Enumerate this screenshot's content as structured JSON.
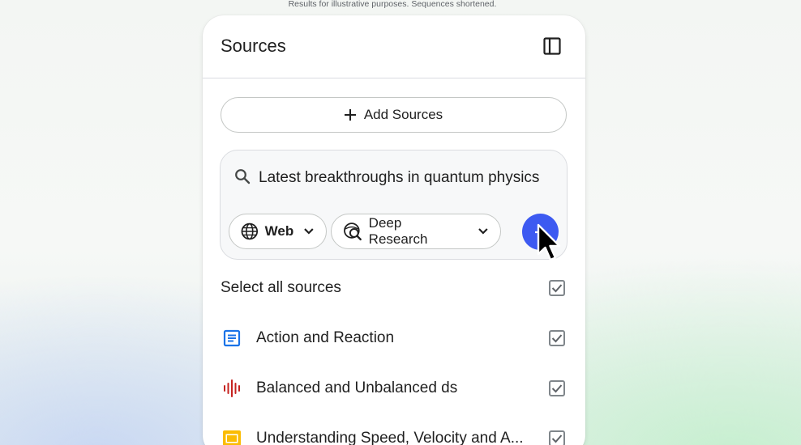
{
  "disclaimer": "Results for illustrative purposes. Sequences shortened.",
  "panel": {
    "title": "Sources",
    "collapse_icon": "side-panel-icon"
  },
  "add_sources": {
    "label": "Add Sources",
    "icon": "plus-icon"
  },
  "search": {
    "query": "Latest breakthroughs in quantum physics",
    "source_chip": {
      "label": "Web",
      "icon": "globe-icon"
    },
    "mode_chip": {
      "label": "Deep Research",
      "icon": "deep-research-icon"
    },
    "submit_icon": "arrow-right-icon",
    "accent_color": "#3d5af1"
  },
  "select_all": {
    "label": "Select all sources",
    "checked": true
  },
  "sources": [
    {
      "title": "Action and Reaction",
      "icon": "document-icon",
      "color": "#1a73e8",
      "checked": true
    },
    {
      "title": "Balanced and Unbalanced ds",
      "icon": "audio-waveform-icon",
      "color": "#c5221f",
      "checked": true
    },
    {
      "title": "Understanding Speed, Velocity and A...",
      "icon": "slides-icon",
      "color": "#fbbc04",
      "checked": true
    }
  ]
}
